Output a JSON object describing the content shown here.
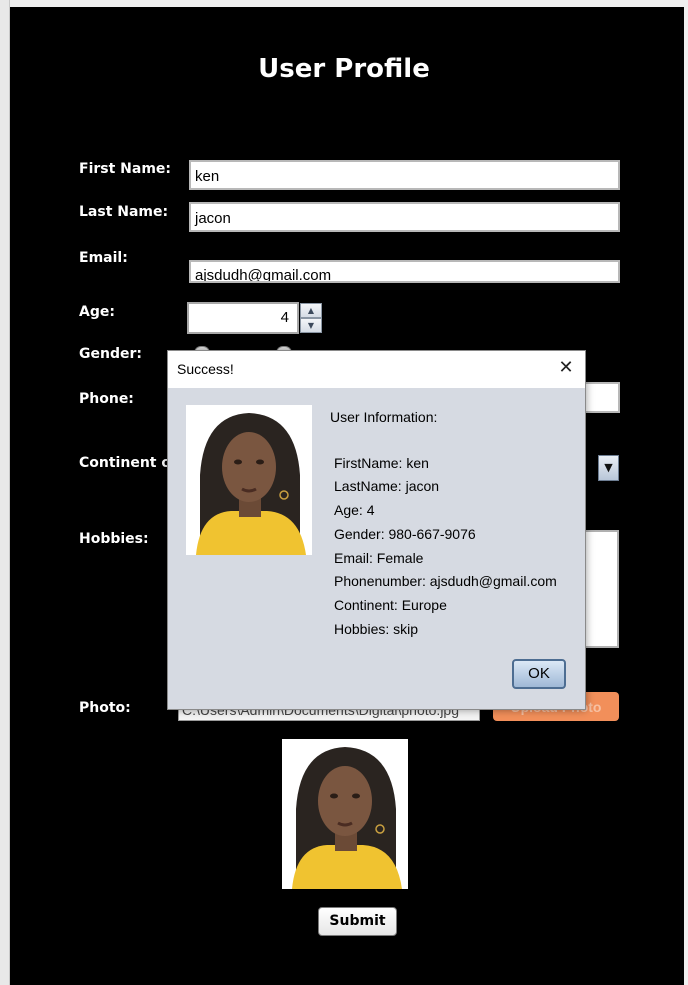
{
  "form": {
    "title": "User Profile",
    "first_name_label": "First Name:",
    "first_name_value": "ken",
    "last_name_label": "Last Name:",
    "last_name_value": "jacon",
    "email_label": "Email:",
    "email_value": "ajsdudh@gmail.com",
    "age_label": "Age:",
    "age_value": "4",
    "gender_label": "Gender:",
    "phone_label": "Phone:",
    "continent_label": "Continent of",
    "hobbies_label": "Hobbies:",
    "photo_label": "Photo:",
    "photo_path": "C:\\Users\\Admin\\Documents\\Digital\\photo.jpg",
    "upload_label": "Upload Photo",
    "submit_label": "Submit"
  },
  "dialog": {
    "title": "Success!",
    "close_icon": "close-icon",
    "info_heading": "User Information:",
    "lines": [
      "FirstName: ken",
      "LastName: jacon",
      "Age: 4",
      "Gender: 980-667-9076",
      "Email: Female",
      "Phonenumber: ajsdudh@gmail.com",
      "Continent: Europe",
      "Hobbies: skip"
    ],
    "ok_label": "OK"
  },
  "colors": {
    "panel_bg": "#000000",
    "upload_btn": "#f28f5a",
    "dialog_bg": "#d6dae2",
    "photo_top": "#2a2420",
    "photo_shirt": "#f0c330"
  },
  "icons": {
    "spinner_up": "chevron-up-icon",
    "spinner_down": "chevron-down-icon",
    "combo": "dropdown-arrow-icon"
  }
}
